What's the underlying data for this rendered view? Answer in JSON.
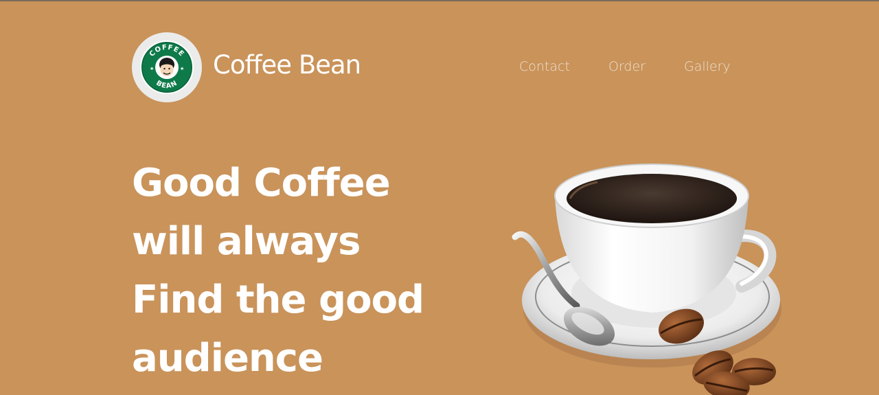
{
  "header": {
    "brand": "Coffee Bean",
    "logo_text_top": "COFFEE",
    "logo_text_bottom": "BEAN"
  },
  "nav": {
    "items": [
      "Contact",
      "Order",
      "Gallery"
    ]
  },
  "hero": {
    "lines": [
      "Good Coffee",
      "will always",
      "Find the good",
      "audience"
    ]
  },
  "colors": {
    "background": "#c9935a",
    "logo_green": "#0e7a4a",
    "text": "#ffffff",
    "nav_text": "#efe0cf"
  },
  "icons": {
    "logo": "coffee-bean-logo",
    "hero_image": "coffee-cup-illustration"
  }
}
